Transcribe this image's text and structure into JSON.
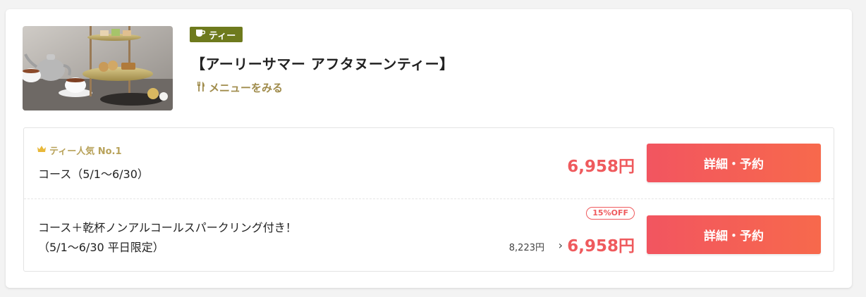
{
  "plan": {
    "category_label": "ティー",
    "category_icon": "cup-icon",
    "title": "【アーリーサマー アフタヌーンティー】",
    "menu_link_label": "メニューをみる",
    "menu_link_icon": "cutlery-icon"
  },
  "courses": [
    {
      "popular_badge": "ティー人気 No.1",
      "popular_icon": "crown-icon",
      "name_line1": "コース（5/1〜6/30）",
      "price": "6,958円",
      "button_label": "詳細・予約"
    },
    {
      "name_line1": "コース＋乾杯ノンアルコールスパークリング付き！",
      "name_line2": "（5/1〜6/30 平日限定）",
      "discount_badge": "15%OFF",
      "original_price": "8,223円",
      "arrow": "›",
      "price": "6,958円",
      "button_label": "詳細・予約"
    }
  ],
  "colors": {
    "category_badge_bg": "#6e7a1d",
    "menu_link": "#a08c4c",
    "popular_badge": "#b8a25a",
    "price": "#ef5a5d",
    "button_gradient_start": "#f25560",
    "button_gradient_end": "#f7694c"
  }
}
